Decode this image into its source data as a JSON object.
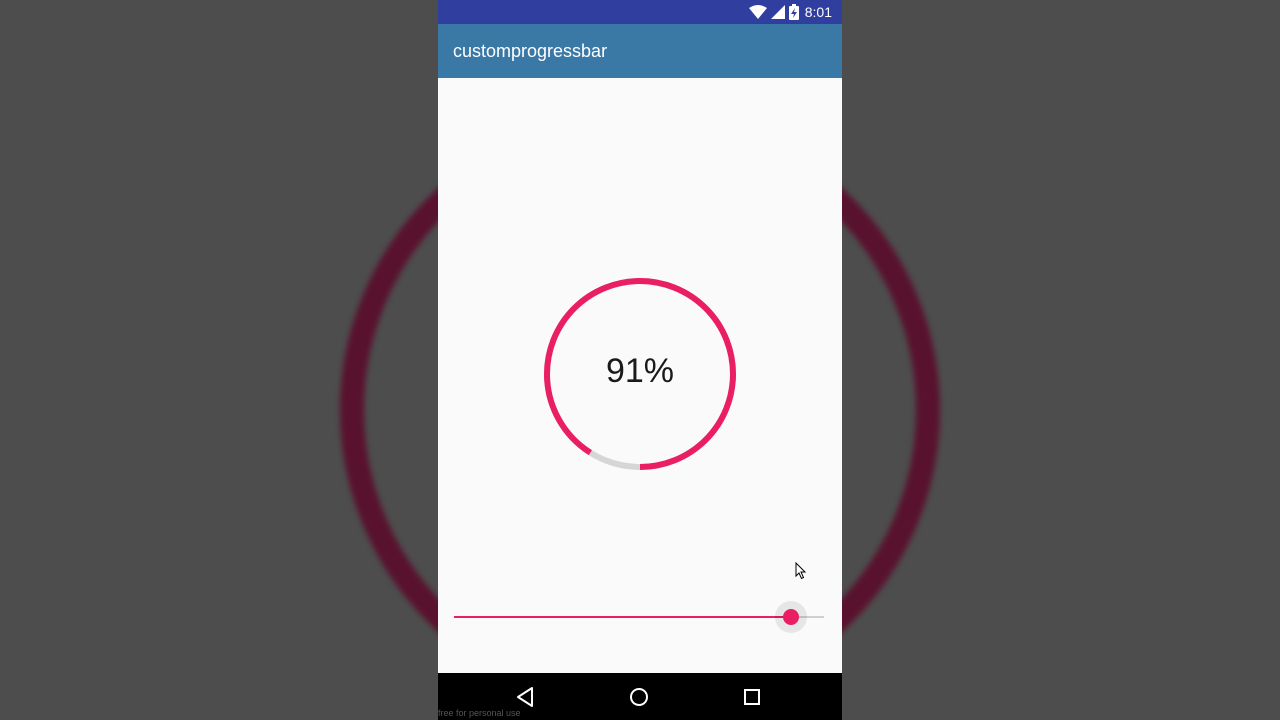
{
  "status_bar": {
    "time": "8:01",
    "icons": [
      "wifi-icon",
      "cellular-signal-icon",
      "battery-charging-icon"
    ],
    "background_color": "#303f9f"
  },
  "app_bar": {
    "title": "customprogressbar",
    "background_color": "#3a78a6"
  },
  "progress": {
    "value_percent": 91,
    "label": "91%",
    "progress_color": "#e91e63",
    "track_color": "#d6d6d6"
  },
  "slider": {
    "value_fraction": 0.91,
    "accent_color": "#e91e63"
  },
  "nav_bar": {
    "buttons": [
      "back-icon",
      "home-icon",
      "recents-icon"
    ]
  },
  "watermark": "free for personal use"
}
